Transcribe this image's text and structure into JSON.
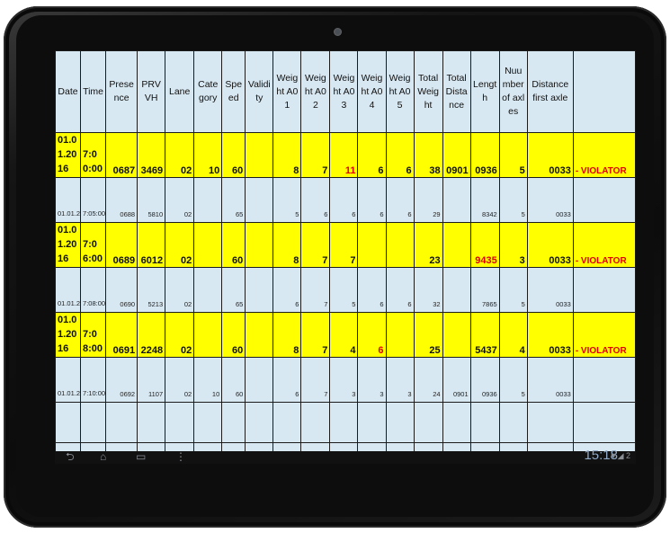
{
  "screen": {
    "clock": "15:18",
    "status": "▼◢ 2"
  },
  "table": {
    "headers": [
      "Date",
      "Time",
      "Presence",
      "PRVVH",
      "Lane",
      "Category",
      "Speed",
      "Validity",
      "Weight A01",
      "Weight A02",
      "Weight A03",
      "Weight A04",
      "Weight A05",
      "Total Weight",
      "Total Distance",
      "Length",
      "Nuumber of axles",
      "Distance first axle",
      ""
    ],
    "rows": [
      {
        "date": "01.01.2016",
        "time": "7:00:00",
        "presence": "0687",
        "prvvh": "3469",
        "lane": "02",
        "category": "10",
        "speed": "60",
        "validity": "",
        "w1": "8",
        "w2": "7",
        "w3": "11",
        "w4": "6",
        "w5": "6",
        "total_weight": "38",
        "total_distance": "0901",
        "length": "0936",
        "axles": "5",
        "dist_first_axle": "0033",
        "flag": "- VIOLATOR"
      },
      {
        "date": "01.01.2016",
        "time": "7:05:00",
        "presence": "0688",
        "prvvh": "5810",
        "lane": "02",
        "category": "",
        "speed": "65",
        "validity": "",
        "w1": "5",
        "w2": "6",
        "w3": "6",
        "w4": "6",
        "w5": "6",
        "total_weight": "29",
        "total_distance": "",
        "length": "8342",
        "axles": "5",
        "dist_first_axle": "0033",
        "flag": ""
      },
      {
        "date": "01.01.2016",
        "time": "7:06:00",
        "presence": "0689",
        "prvvh": "6012",
        "lane": "02",
        "category": "",
        "speed": "60",
        "validity": "",
        "w1": "8",
        "w2": "7",
        "w3": "7",
        "w4": "",
        "w5": "",
        "total_weight": "23",
        "total_distance": "",
        "length": "9435",
        "axles": "3",
        "dist_first_axle": "0033",
        "flag": "- VIOLATOR"
      },
      {
        "date": "01.01.2016",
        "time": "7:08:00",
        "presence": "0690",
        "prvvh": "5213",
        "lane": "02",
        "category": "",
        "speed": "65",
        "validity": "",
        "w1": "6",
        "w2": "7",
        "w3": "5",
        "w4": "6",
        "w5": "6",
        "total_weight": "32",
        "total_distance": "",
        "length": "7865",
        "axles": "5",
        "dist_first_axle": "0033",
        "flag": ""
      },
      {
        "date": "01.01.2016",
        "time": "7:08:00",
        "presence": "0691",
        "prvvh": "2248",
        "lane": "02",
        "category": "",
        "speed": "60",
        "validity": "",
        "w1": "8",
        "w2": "7",
        "w3": "4",
        "w4": "6",
        "w5": "",
        "total_weight": "25",
        "total_distance": "",
        "length": "5437",
        "axles": "4",
        "dist_first_axle": "0033",
        "flag": "- VIOLATOR"
      },
      {
        "date": "01.01.2016",
        "time": "7:10:00",
        "presence": "0692",
        "prvvh": "1107",
        "lane": "02",
        "category": "10",
        "speed": "60",
        "validity": "",
        "w1": "6",
        "w2": "7",
        "w3": "3",
        "w4": "3",
        "w5": "3",
        "total_weight": "24",
        "total_distance": "0901",
        "length": "0936",
        "axles": "5",
        "dist_first_axle": "0033",
        "flag": ""
      }
    ]
  },
  "colors": {
    "highlight": "#ffff00",
    "normal": "#d8e8f2",
    "violator": "#e00000"
  }
}
